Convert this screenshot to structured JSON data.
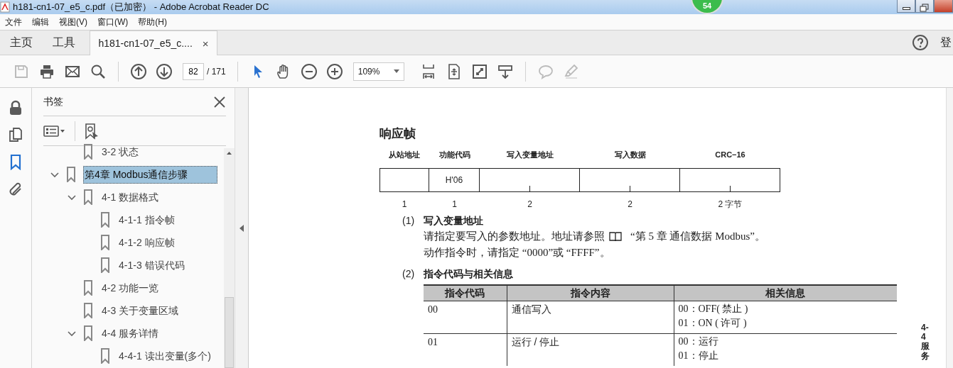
{
  "window": {
    "title": "h181-cn1-07_e5_c.pdf（已加密） - Adobe Acrobat Reader DC",
    "badge": "54"
  },
  "menu": [
    "文件",
    "编辑",
    "视图(V)",
    "窗口(W)",
    "帮助(H)"
  ],
  "tabs": [
    {
      "label": "主页",
      "selected": false
    },
    {
      "label": "工具",
      "selected": false
    },
    {
      "label": "h181-cn1-07_e5_c....",
      "selected": true,
      "close_label": "×"
    }
  ],
  "account_label": "登",
  "toolbar": {
    "page_number": "82",
    "page_count": "/ 171",
    "zoom": "109%"
  },
  "side_panel_tabs": [
    {
      "selected": false
    },
    {
      "selected": false
    },
    {
      "selected": true
    },
    {
      "selected": false
    }
  ],
  "bookmarks_panel": {
    "title": "书签",
    "bookmarks": [
      {
        "kind": "continued",
        "children": [
          {
            "label": "3-2 状态",
            "selected": false
          }
        ]
      },
      {
        "label": "第4章 Modbus通信步骤",
        "selected": true,
        "expanded": true,
        "children": [
          {
            "label": "4-1 数据格式",
            "selected": false,
            "expanded": true,
            "children": [
              {
                "label": "4-1-1 指令帧",
                "selected": false
              },
              {
                "label": "4-1-2 响应帧",
                "selected": false
              },
              {
                "label": "4-1-3 错误代码",
                "selected": false
              }
            ]
          },
          {
            "label": "4-2 功能一览",
            "selected": false
          },
          {
            "label": "4-3 关于变量区域",
            "selected": false
          },
          {
            "label": "4-4 服务详情",
            "selected": false,
            "expanded": true,
            "children": [
              {
                "label": "4-4-1 读出变量(多个)",
                "selected": false
              }
            ]
          }
        ]
      }
    ]
  },
  "document": {
    "heading": "响应帧",
    "frame": {
      "fields": [
        {
          "label": "从站地址",
          "size": "1"
        },
        {
          "label": "功能代码",
          "value": "H'06",
          "size": "1"
        },
        {
          "label": "写入变量地址",
          "size": "2"
        },
        {
          "label": "写入数据",
          "size": "2"
        },
        {
          "label": "CRC−16",
          "size": "2 字节"
        }
      ]
    },
    "sections": [
      {
        "number": "(1)",
        "title": "写入变量地址",
        "paragraphs": [
          {
            "before": "请指定要写入的参数地址。地址请参照",
            "after": "“第 5 章 通信数据 Modbus”。"
          },
          {
            "before": "动作指令时，请指定 “0000”或 “FFFF”。"
          }
        ]
      },
      {
        "number": "(2)",
        "title": "指令代码与相关信息"
      }
    ],
    "table": {
      "columns": [
        "指令代码",
        "指令内容",
        "相关信息"
      ],
      "rows": [
        {
          "code": "00",
          "content": "通信写入",
          "info": [
            "00：OFF( 禁止 )",
            "01：ON ( 许可 )"
          ]
        },
        {
          "code": "01",
          "content": "运行 / 停止",
          "info": [
            "00：运行",
            "01：停止"
          ]
        }
      ]
    },
    "side_label": "4-4 服务"
  }
}
